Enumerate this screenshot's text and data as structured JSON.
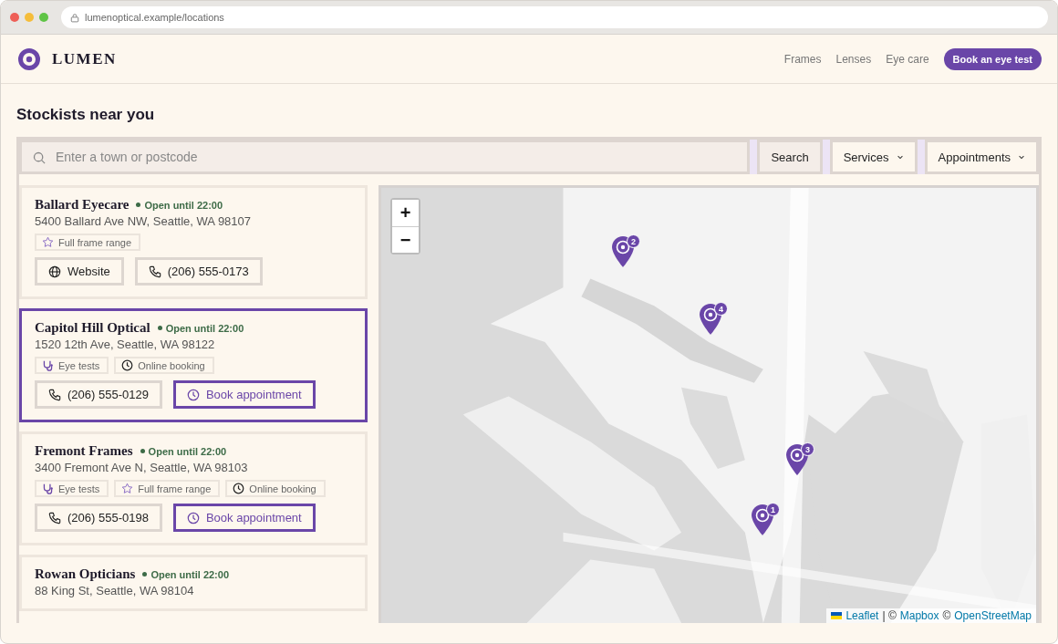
{
  "browser": {
    "url": "lumenoptical.example/locations"
  },
  "header": {
    "brand": "LUMEN",
    "nav": [
      {
        "label": "Frames",
        "kind": "link"
      },
      {
        "label": "Lenses",
        "kind": "link"
      },
      {
        "label": "Eye care",
        "kind": "link"
      },
      {
        "label": "Book an eye test",
        "kind": "cta"
      }
    ]
  },
  "title": "Stockists near you",
  "search": {
    "placeholder": "Enter a town or postcode",
    "button": "Search",
    "filters": [
      "Services",
      "Appointments"
    ]
  },
  "stores": [
    {
      "name": "Ballard Eyecare",
      "status": "Open until 22:00",
      "address": "5400 Ballard Ave NW, Seattle, WA 98107",
      "selected": false,
      "tags": [
        {
          "kind": "frames",
          "label": "Full frame range"
        }
      ],
      "actions": [
        {
          "kind": "website",
          "label": "Website"
        },
        {
          "kind": "phone",
          "label": "(206) 555-0173"
        }
      ]
    },
    {
      "name": "Capitol Hill Optical",
      "status": "Open until 22:00",
      "address": "1520 12th Ave, Seattle, WA 98122",
      "selected": true,
      "tags": [
        {
          "kind": "tests",
          "label": "Eye tests"
        },
        {
          "kind": "booking",
          "label": "Online booking"
        }
      ],
      "actions": [
        {
          "kind": "phone",
          "label": "(206) 555-0129"
        },
        {
          "kind": "book",
          "label": "Book appointment"
        }
      ]
    },
    {
      "name": "Fremont Frames",
      "status": "Open until 22:00",
      "address": "3400 Fremont Ave N, Seattle, WA 98103",
      "selected": false,
      "tags": [
        {
          "kind": "tests",
          "label": "Eye tests"
        },
        {
          "kind": "frames",
          "label": "Full frame range"
        },
        {
          "kind": "booking",
          "label": "Online booking"
        }
      ],
      "actions": [
        {
          "kind": "phone",
          "label": "(206) 555-0198"
        },
        {
          "kind": "book",
          "label": "Book appointment"
        }
      ]
    },
    {
      "name": "Rowan Opticians",
      "status": "Open until 22:00",
      "address": "88 King St, Seattle, WA 98104",
      "selected": false
    }
  ],
  "map": {
    "kind": "picture",
    "zoom": [
      "+",
      "−"
    ],
    "markers": [
      {
        "number": "2"
      },
      {
        "number": "4"
      },
      {
        "number": "3"
      },
      {
        "number": "1"
      }
    ],
    "attribution": [
      {
        "kind": "link",
        "text": "Leaflet"
      },
      {
        "kind": "plain",
        "text": "| ©"
      },
      {
        "kind": "link",
        "text": "Mapbox"
      },
      {
        "kind": "plain",
        "text": "©"
      },
      {
        "kind": "link",
        "text": "OpenStreetMap"
      }
    ]
  }
}
